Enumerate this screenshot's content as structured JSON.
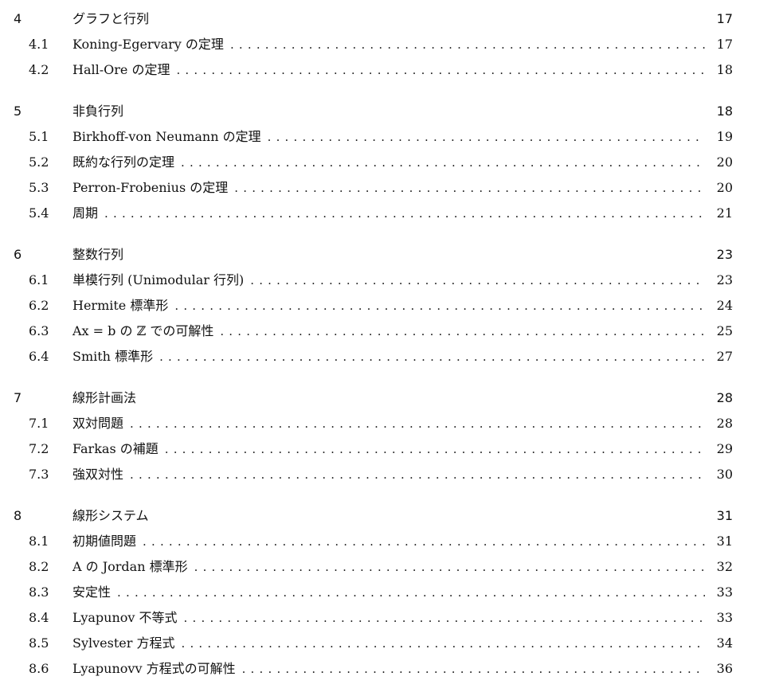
{
  "toc": {
    "chapters": [
      {
        "num": "4",
        "title": "グラフと行列",
        "page": "17",
        "sections": [
          {
            "num": "4.1",
            "title": "Koning-Egervary の定理",
            "page": "17"
          },
          {
            "num": "4.2",
            "title": "Hall-Ore の定理",
            "page": "18"
          }
        ]
      },
      {
        "num": "5",
        "title": "非負行列",
        "page": "18",
        "sections": [
          {
            "num": "5.1",
            "title": "Birkhoff-von Neumann の定理",
            "page": "19"
          },
          {
            "num": "5.2",
            "title": "既約な行列の定理",
            "page": "20"
          },
          {
            "num": "5.3",
            "title": "Perron-Frobenius の定理",
            "page": "20"
          },
          {
            "num": "5.4",
            "title": "周期",
            "page": "21"
          }
        ]
      },
      {
        "num": "6",
        "title": "整数行列",
        "page": "23",
        "sections": [
          {
            "num": "6.1",
            "title": "単模行列 (Unimodular 行列)",
            "page": "23"
          },
          {
            "num": "6.2",
            "title": "Hermite 標準形",
            "page": "24"
          },
          {
            "num": "6.3",
            "title": "Ax = b の ℤ での可解性",
            "page": "25"
          },
          {
            "num": "6.4",
            "title": "Smith 標準形",
            "page": "27"
          }
        ]
      },
      {
        "num": "7",
        "title": "線形計画法",
        "page": "28",
        "sections": [
          {
            "num": "7.1",
            "title": "双対問題",
            "page": "28"
          },
          {
            "num": "7.2",
            "title": "Farkas の補題",
            "page": "29"
          },
          {
            "num": "7.3",
            "title": "強双対性",
            "page": "30"
          }
        ]
      },
      {
        "num": "8",
        "title": "線形システム",
        "page": "31",
        "sections": [
          {
            "num": "8.1",
            "title": "初期値問題",
            "page": "31"
          },
          {
            "num": "8.2",
            "title": "A の Jordan 標準形",
            "page": "32"
          },
          {
            "num": "8.3",
            "title": "安定性",
            "page": "33"
          },
          {
            "num": "8.4",
            "title": "Lyapunov 不等式",
            "page": "33"
          },
          {
            "num": "8.5",
            "title": "Sylvester 方程式",
            "page": "34"
          },
          {
            "num": "8.6",
            "title": "Lyapunovv 方程式の可解性",
            "page": "36"
          }
        ]
      }
    ]
  }
}
